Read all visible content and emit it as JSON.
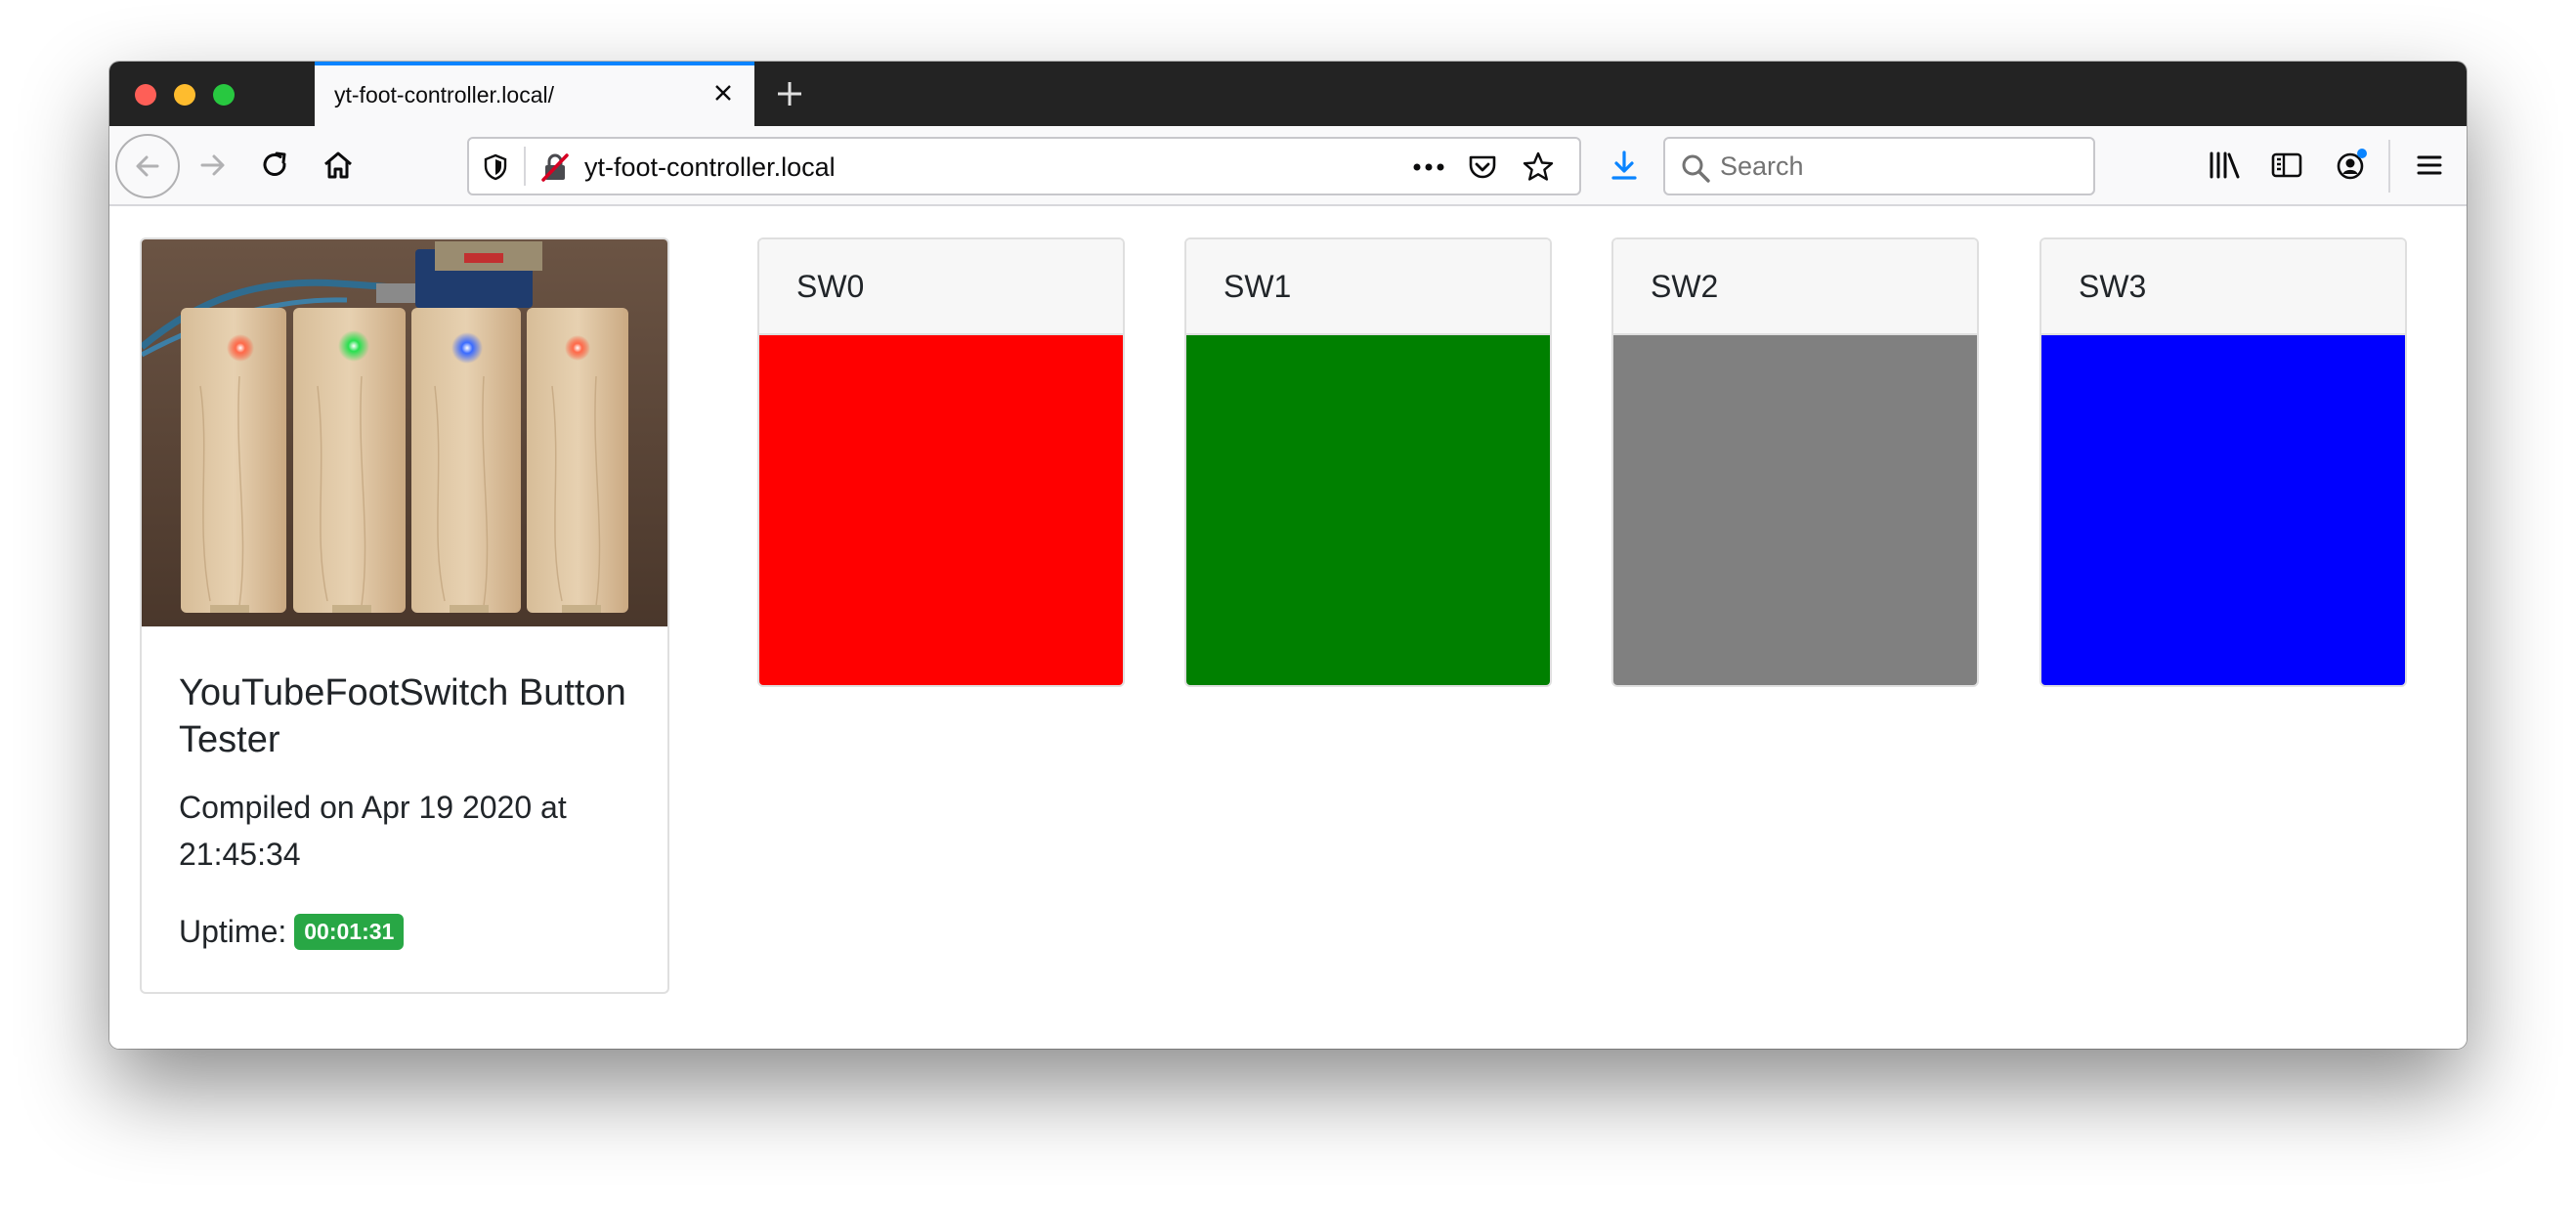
{
  "browser": {
    "tab_title": "yt-foot-controller.local/",
    "url": "yt-foot-controller.local",
    "search_placeholder": "Search"
  },
  "info": {
    "title": "YouTubeFootSwitch Button Tester",
    "compiled": "Compiled on Apr 19 2020 at 21:45:34",
    "uptime_label": "Uptime:",
    "uptime_value": "00:01:31",
    "uptime_badge_color": "#28a745"
  },
  "switches": [
    {
      "label": "SW0",
      "color": "#ff0000"
    },
    {
      "label": "SW1",
      "color": "#008000"
    },
    {
      "label": "SW2",
      "color": "#808080"
    },
    {
      "label": "SW3",
      "color": "#0000ff"
    }
  ],
  "icons": [
    "back-arrow-icon",
    "forward-arrow-icon",
    "reload-icon",
    "home-icon",
    "shield-icon",
    "insecure-lock-icon",
    "more-actions-icon",
    "pocket-icon",
    "star-icon",
    "download-icon",
    "search-icon",
    "library-icon",
    "sidebar-icon",
    "account-icon",
    "hamburger-menu-icon",
    "close-tab-icon",
    "plus-icon"
  ]
}
